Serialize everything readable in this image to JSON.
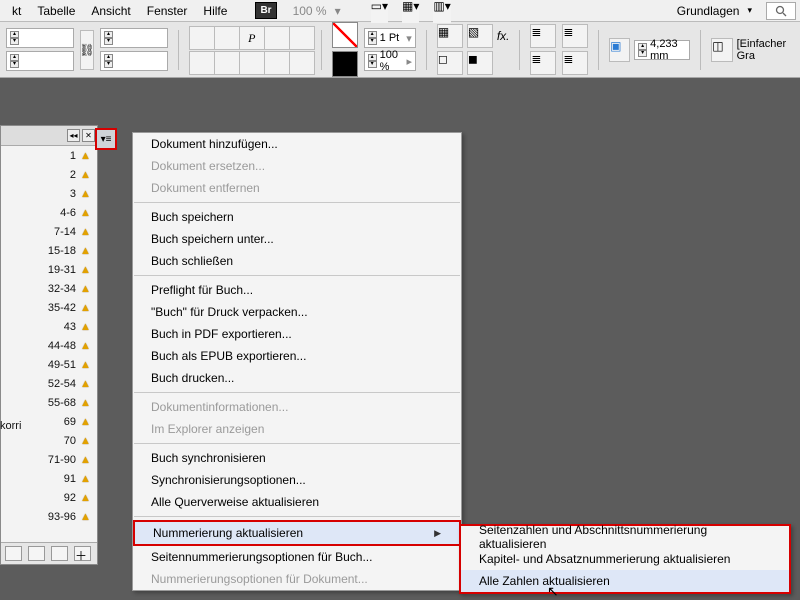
{
  "menubar": {
    "items": [
      "kt",
      "Tabelle",
      "Ansicht",
      "Fenster",
      "Hilfe"
    ],
    "bridge_label": "Br",
    "zoom": "100 %",
    "workspace_label": "Grundlagen"
  },
  "toolbar": {
    "stroke_weight": "1 Pt",
    "opacity": "100 %",
    "measurement": "4,233 mm",
    "text_placeholder": "[Einfacher Gra"
  },
  "book_panel": {
    "rows": [
      {
        "range": "1"
      },
      {
        "range": "2"
      },
      {
        "range": "3"
      },
      {
        "range": "4-6"
      },
      {
        "range": "7-14"
      },
      {
        "range": "15-18"
      },
      {
        "range": "19-31"
      },
      {
        "range": "32-34"
      },
      {
        "range": "35-42"
      },
      {
        "range": "43"
      },
      {
        "range": "44-48"
      },
      {
        "range": "49-51"
      },
      {
        "range": "52-54"
      },
      {
        "range": "55-68"
      },
      {
        "range": "69"
      },
      {
        "range": "70"
      },
      {
        "range": "71-90"
      },
      {
        "range": "91"
      },
      {
        "range": "92"
      },
      {
        "range": "93-96"
      }
    ],
    "truncated_label": "korri"
  },
  "context_menu": {
    "items": [
      {
        "label": "Dokument hinzufügen...",
        "disabled": false
      },
      {
        "label": "Dokument ersetzen...",
        "disabled": true
      },
      {
        "label": "Dokument entfernen",
        "disabled": true
      },
      {
        "sep": true
      },
      {
        "label": "Buch speichern"
      },
      {
        "label": "Buch speichern unter..."
      },
      {
        "label": "Buch schließen"
      },
      {
        "sep": true
      },
      {
        "label": "Preflight für Buch..."
      },
      {
        "label": "\"Buch\" für Druck verpacken..."
      },
      {
        "label": "Buch in PDF exportieren..."
      },
      {
        "label": "Buch als EPUB exportieren..."
      },
      {
        "label": "Buch drucken..."
      },
      {
        "sep": true
      },
      {
        "label": "Dokumentinformationen...",
        "disabled": true
      },
      {
        "label": "Im Explorer anzeigen",
        "disabled": true
      },
      {
        "sep": true
      },
      {
        "label": "Buch synchronisieren"
      },
      {
        "label": "Synchronisierungsoptionen..."
      },
      {
        "label": "Alle Querverweise aktualisieren"
      },
      {
        "sep": true
      },
      {
        "label": "Nummerierung aktualisieren",
        "submenu": true,
        "highlighted": true
      },
      {
        "label": "Seitennummerierungsoptionen für Buch..."
      },
      {
        "label": "Nummerierungsoptionen für Dokument...",
        "disabled": true
      }
    ],
    "submenu": {
      "items": [
        {
          "label": "Seitenzahlen und Abschnittsnummerierung aktualisieren"
        },
        {
          "label": "Kapitel- und Absatznummerierung aktualisieren"
        },
        {
          "label": "Alle Zahlen aktualisieren",
          "hover": true
        }
      ]
    }
  }
}
